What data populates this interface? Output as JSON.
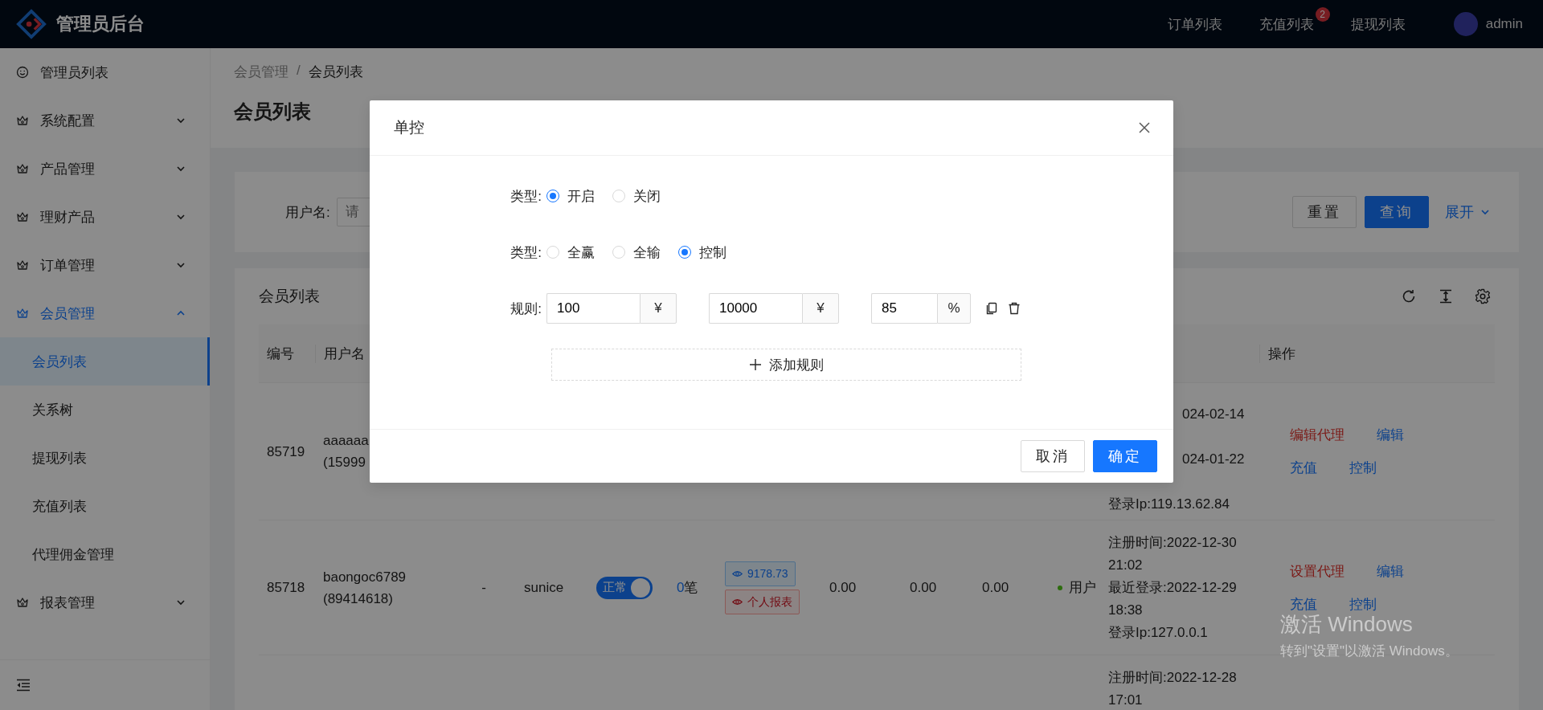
{
  "header": {
    "title": "管理员后台",
    "nav": [
      {
        "label": "订单列表"
      },
      {
        "label": "充值列表",
        "badge": "2"
      },
      {
        "label": "提现列表"
      }
    ],
    "user": "admin"
  },
  "sidebar": {
    "items": [
      {
        "kind": "link",
        "label": "管理员列表"
      },
      {
        "kind": "group",
        "label": "系统配置",
        "expanded": false
      },
      {
        "kind": "group",
        "label": "产品管理",
        "expanded": false
      },
      {
        "kind": "group",
        "label": "理财产品",
        "expanded": false
      },
      {
        "kind": "group",
        "label": "订单管理",
        "expanded": false
      },
      {
        "kind": "group",
        "label": "会员管理",
        "expanded": true,
        "children": [
          {
            "label": "会员列表",
            "selected": true
          },
          {
            "label": "关系树",
            "selected": false
          },
          {
            "label": "提现列表",
            "selected": false
          },
          {
            "label": "充值列表",
            "selected": false
          },
          {
            "label": "代理佣金管理",
            "selected": false
          }
        ]
      },
      {
        "kind": "group",
        "label": "报表管理",
        "expanded": false
      }
    ]
  },
  "breadcrumb": [
    "会员管理",
    "会员列表"
  ],
  "breadcrumb_separator": "/",
  "page_title": "会员列表",
  "search": {
    "label": "用户名:",
    "placeholder": "请",
    "buttons": [
      {
        "label": "重置",
        "kind": "default"
      },
      {
        "label": "查询",
        "kind": "primary"
      }
    ],
    "expand": "展开"
  },
  "table": {
    "title": "会员列表",
    "columns": [
      {
        "label": "编号"
      },
      {
        "label": "用户名"
      },
      {
        "label": "操作"
      }
    ],
    "rows": [
      {
        "id": "85719",
        "user": [
          "aaaaaa",
          "(15999"
        ],
        "time": [
          "024-02-14",
          "024-01-22",
          "登录Ip:119.13.62.84"
        ],
        "actions": [
          {
            "label": "编辑代理",
            "kind": "danger"
          },
          {
            "label": "编辑",
            "kind": "link"
          },
          {
            "label": "充值",
            "kind": "link"
          },
          {
            "label": "控制",
            "kind": "link"
          }
        ]
      },
      {
        "id": "85718",
        "user": [
          "baongoc6789",
          "(89414618)"
        ],
        "column_3": "-",
        "column_4": "sunice",
        "switch": {
          "label": "正常",
          "on": true
        },
        "count": "0",
        "count_unit": "笔",
        "tags": [
          {
            "text": "9178.73",
            "kind": "info"
          },
          {
            "text": "个人报表",
            "kind": "danger"
          }
        ],
        "amounts": [
          "0.00",
          "0.00",
          "0.00"
        ],
        "status": {
          "label": "用户",
          "color": "#2d6c0e"
        },
        "time": [
          "注册时间:2022-12-30",
          "21:02",
          "最近登录:2022-12-29",
          "18:38",
          "登录Ip:127.0.0.1"
        ],
        "actions": [
          {
            "label": "设置代理",
            "kind": "danger"
          },
          {
            "label": "编辑",
            "kind": "link"
          },
          {
            "label": "充值",
            "kind": "link"
          },
          {
            "label": "控制",
            "kind": "link"
          }
        ]
      },
      {
        "time": [
          "注册时间:2022-12-28",
          "17:01"
        ]
      }
    ]
  },
  "modal": {
    "title": "单控",
    "fields": [
      {
        "kind": "radio",
        "label": "类型:",
        "options": [
          {
            "label": "开启",
            "selected": true
          },
          {
            "label": "关闭",
            "selected": false
          }
        ]
      },
      {
        "kind": "radio",
        "label": "类型:",
        "options": [
          {
            "label": "全赢",
            "selected": false
          },
          {
            "label": "全输",
            "selected": false
          },
          {
            "label": "控制",
            "selected": true
          }
        ]
      },
      {
        "kind": "rules",
        "label": "规则:",
        "inputs": [
          {
            "value": "100",
            "suffix": "¥"
          },
          {
            "value": "10000",
            "suffix": "¥"
          },
          {
            "value": "85",
            "suffix": "%"
          }
        ]
      }
    ],
    "add_button": "添加规则",
    "buttons": [
      {
        "label": "取消",
        "kind": "default"
      },
      {
        "label": "确定",
        "kind": "primary"
      }
    ]
  },
  "activation": {
    "title": "激活 Windows",
    "subtitle": "转到\"设置\"以激活 Windows。"
  }
}
